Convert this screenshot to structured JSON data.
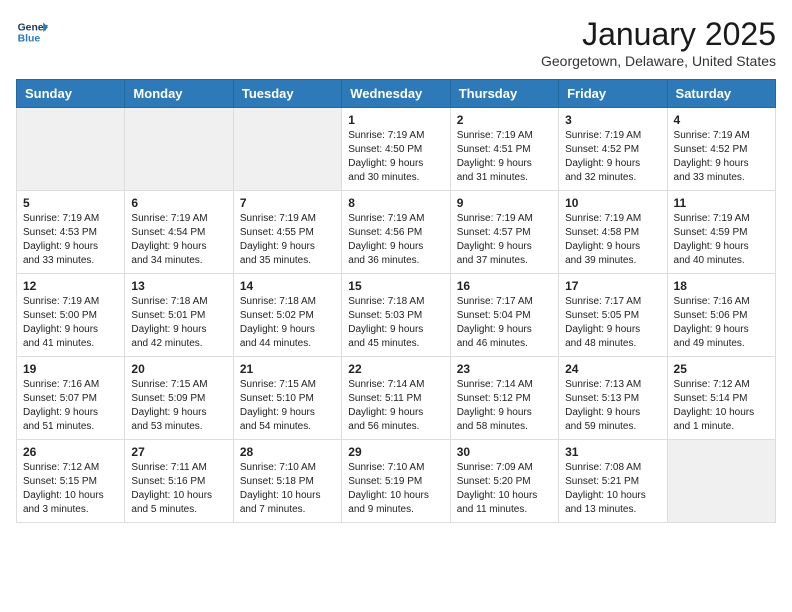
{
  "header": {
    "logo_line1": "General",
    "logo_line2": "Blue",
    "month_title": "January 2025",
    "location": "Georgetown, Delaware, United States"
  },
  "weekdays": [
    "Sunday",
    "Monday",
    "Tuesday",
    "Wednesday",
    "Thursday",
    "Friday",
    "Saturday"
  ],
  "weeks": [
    [
      {
        "day": null,
        "info": null
      },
      {
        "day": null,
        "info": null
      },
      {
        "day": null,
        "info": null
      },
      {
        "day": "1",
        "info": "Sunrise: 7:19 AM\nSunset: 4:50 PM\nDaylight: 9 hours\nand 30 minutes."
      },
      {
        "day": "2",
        "info": "Sunrise: 7:19 AM\nSunset: 4:51 PM\nDaylight: 9 hours\nand 31 minutes."
      },
      {
        "day": "3",
        "info": "Sunrise: 7:19 AM\nSunset: 4:52 PM\nDaylight: 9 hours\nand 32 minutes."
      },
      {
        "day": "4",
        "info": "Sunrise: 7:19 AM\nSunset: 4:52 PM\nDaylight: 9 hours\nand 33 minutes."
      }
    ],
    [
      {
        "day": "5",
        "info": "Sunrise: 7:19 AM\nSunset: 4:53 PM\nDaylight: 9 hours\nand 33 minutes."
      },
      {
        "day": "6",
        "info": "Sunrise: 7:19 AM\nSunset: 4:54 PM\nDaylight: 9 hours\nand 34 minutes."
      },
      {
        "day": "7",
        "info": "Sunrise: 7:19 AM\nSunset: 4:55 PM\nDaylight: 9 hours\nand 35 minutes."
      },
      {
        "day": "8",
        "info": "Sunrise: 7:19 AM\nSunset: 4:56 PM\nDaylight: 9 hours\nand 36 minutes."
      },
      {
        "day": "9",
        "info": "Sunrise: 7:19 AM\nSunset: 4:57 PM\nDaylight: 9 hours\nand 37 minutes."
      },
      {
        "day": "10",
        "info": "Sunrise: 7:19 AM\nSunset: 4:58 PM\nDaylight: 9 hours\nand 39 minutes."
      },
      {
        "day": "11",
        "info": "Sunrise: 7:19 AM\nSunset: 4:59 PM\nDaylight: 9 hours\nand 40 minutes."
      }
    ],
    [
      {
        "day": "12",
        "info": "Sunrise: 7:19 AM\nSunset: 5:00 PM\nDaylight: 9 hours\nand 41 minutes."
      },
      {
        "day": "13",
        "info": "Sunrise: 7:18 AM\nSunset: 5:01 PM\nDaylight: 9 hours\nand 42 minutes."
      },
      {
        "day": "14",
        "info": "Sunrise: 7:18 AM\nSunset: 5:02 PM\nDaylight: 9 hours\nand 44 minutes."
      },
      {
        "day": "15",
        "info": "Sunrise: 7:18 AM\nSunset: 5:03 PM\nDaylight: 9 hours\nand 45 minutes."
      },
      {
        "day": "16",
        "info": "Sunrise: 7:17 AM\nSunset: 5:04 PM\nDaylight: 9 hours\nand 46 minutes."
      },
      {
        "day": "17",
        "info": "Sunrise: 7:17 AM\nSunset: 5:05 PM\nDaylight: 9 hours\nand 48 minutes."
      },
      {
        "day": "18",
        "info": "Sunrise: 7:16 AM\nSunset: 5:06 PM\nDaylight: 9 hours\nand 49 minutes."
      }
    ],
    [
      {
        "day": "19",
        "info": "Sunrise: 7:16 AM\nSunset: 5:07 PM\nDaylight: 9 hours\nand 51 minutes."
      },
      {
        "day": "20",
        "info": "Sunrise: 7:15 AM\nSunset: 5:09 PM\nDaylight: 9 hours\nand 53 minutes."
      },
      {
        "day": "21",
        "info": "Sunrise: 7:15 AM\nSunset: 5:10 PM\nDaylight: 9 hours\nand 54 minutes."
      },
      {
        "day": "22",
        "info": "Sunrise: 7:14 AM\nSunset: 5:11 PM\nDaylight: 9 hours\nand 56 minutes."
      },
      {
        "day": "23",
        "info": "Sunrise: 7:14 AM\nSunset: 5:12 PM\nDaylight: 9 hours\nand 58 minutes."
      },
      {
        "day": "24",
        "info": "Sunrise: 7:13 AM\nSunset: 5:13 PM\nDaylight: 9 hours\nand 59 minutes."
      },
      {
        "day": "25",
        "info": "Sunrise: 7:12 AM\nSunset: 5:14 PM\nDaylight: 10 hours\nand 1 minute."
      }
    ],
    [
      {
        "day": "26",
        "info": "Sunrise: 7:12 AM\nSunset: 5:15 PM\nDaylight: 10 hours\nand 3 minutes."
      },
      {
        "day": "27",
        "info": "Sunrise: 7:11 AM\nSunset: 5:16 PM\nDaylight: 10 hours\nand 5 minutes."
      },
      {
        "day": "28",
        "info": "Sunrise: 7:10 AM\nSunset: 5:18 PM\nDaylight: 10 hours\nand 7 minutes."
      },
      {
        "day": "29",
        "info": "Sunrise: 7:10 AM\nSunset: 5:19 PM\nDaylight: 10 hours\nand 9 minutes."
      },
      {
        "day": "30",
        "info": "Sunrise: 7:09 AM\nSunset: 5:20 PM\nDaylight: 10 hours\nand 11 minutes."
      },
      {
        "day": "31",
        "info": "Sunrise: 7:08 AM\nSunset: 5:21 PM\nDaylight: 10 hours\nand 13 minutes."
      },
      {
        "day": null,
        "info": null
      }
    ]
  ]
}
